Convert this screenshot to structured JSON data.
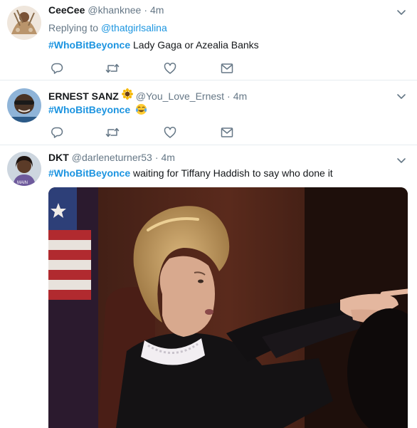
{
  "tweets": [
    {
      "name": "CeeCee",
      "handle": "@khanknee",
      "separator": "·",
      "time": "4m",
      "replying_prefix": "Replying to",
      "replying_handle": "@thatgirlsalina",
      "hashtag": "#WhoBitBeyonce",
      "text": "Lady Gaga or Azealia Banks"
    },
    {
      "name": "ERNEST SANZ",
      "name_emoji": "sunflower-icon",
      "handle": "@You_Love_Ernest",
      "separator": "·",
      "time": "4m",
      "hashtag": "#WhoBitBeyonce",
      "text_emoji": "tears-of-joy-icon"
    },
    {
      "name": "DKT",
      "handle": "@darleneturner53",
      "separator": "·",
      "time": "4m",
      "hashtag": "#WhoBitBeyonce",
      "text": "waiting for Tiffany Haddish to say who done it",
      "media": "judge-pointing-gif"
    }
  ],
  "action_icons": [
    "reply-icon",
    "retweet-icon",
    "like-icon",
    "message-icon"
  ],
  "colors": {
    "link": "#1b95e0",
    "secondary_text": "#657786",
    "icon": "#657786",
    "divider": "#e6ecf0"
  }
}
